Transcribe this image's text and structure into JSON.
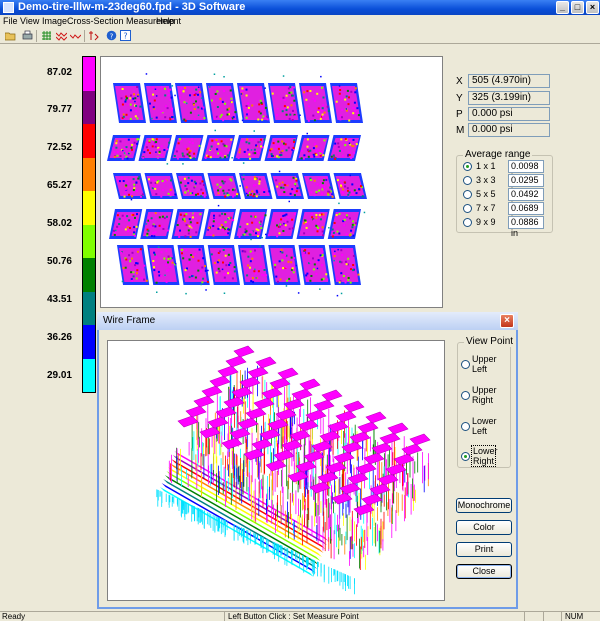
{
  "window": {
    "title": "Demo-tire-lllw-m-23deg60.fpd - 3D Software"
  },
  "menu": [
    "File",
    "View",
    "Image",
    "Cross-Section Measurement",
    "Help"
  ],
  "toolbar": {
    "icons": [
      "open-icon",
      "print-icon",
      "grid-icon",
      "peaks-icon",
      "cursor-icon",
      "help-icon",
      "about-icon"
    ]
  },
  "scale": {
    "labels": [
      "87.02",
      "79.77",
      "72.52",
      "65.27",
      "58.02",
      "50.76",
      "43.51",
      "36.26",
      "29.01"
    ],
    "colors": [
      "#ff00ff",
      "#800080",
      "#ff0000",
      "#ff8000",
      "#ffff00",
      "#80ff00",
      "#008000",
      "#008080",
      "#0000ff",
      "#00ffff"
    ]
  },
  "readout": {
    "x_label": "X",
    "x_value": "505 (4.970in)",
    "y_label": "Y",
    "y_value": "325 (3.199in)",
    "p_label": "P",
    "p_value": "0.000 psi",
    "m_label": "M",
    "m_value": "0.000 psi"
  },
  "average_range": {
    "title": "Average range",
    "options": [
      {
        "label": "1 x 1",
        "value": "0.0098 in",
        "checked": true
      },
      {
        "label": "3 x 3",
        "value": "0.0295 in",
        "checked": false
      },
      {
        "label": "5 x 5",
        "value": "0.0492 in",
        "checked": false
      },
      {
        "label": "7 x 7",
        "value": "0.0689 in",
        "checked": false
      },
      {
        "label": "9 x 9",
        "value": "0.0886 in",
        "checked": false
      }
    ]
  },
  "wireframe": {
    "title": "Wire Frame",
    "viewpoint_title": "View Point",
    "viewpoints": [
      {
        "label": "Upper Left",
        "checked": false
      },
      {
        "label": "Upper Right",
        "checked": false
      },
      {
        "label": "Lower Left",
        "checked": false
      },
      {
        "label": "Lower Right",
        "checked": true
      }
    ],
    "buttons": {
      "monochrome": "Monochrome",
      "color": "Color",
      "print": "Print",
      "close": "Close"
    }
  },
  "status": {
    "left": "Ready",
    "center": "Left Button Click : Set Measure Point",
    "num": "NUM"
  }
}
